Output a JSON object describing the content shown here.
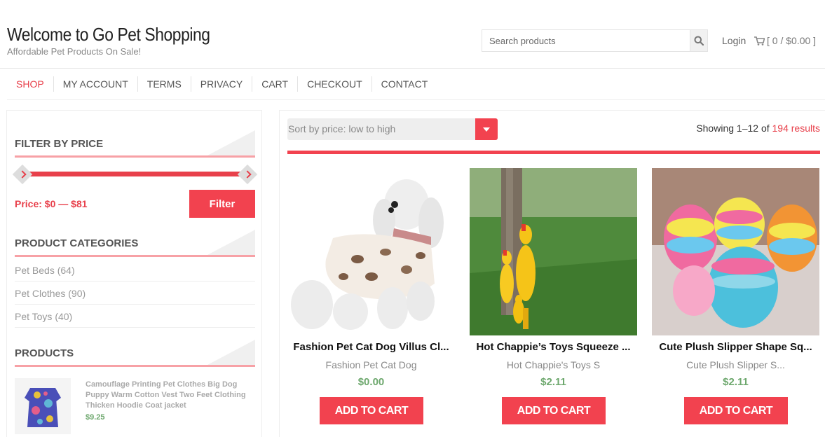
{
  "header": {
    "site_title": "Welcome to Go Pet Shopping",
    "tagline": "Affordable Pet Products On Sale!",
    "search_placeholder": "Search products",
    "login": "Login",
    "cart_summary": "[ 0 / $0.00 ]"
  },
  "nav": {
    "items": [
      "SHOP",
      "MY ACCOUNT",
      "TERMS",
      "PRIVACY",
      "CART",
      "CHECKOUT",
      "CONTACT"
    ],
    "active": "SHOP"
  },
  "sidebar": {
    "price_filter": {
      "title": "FILTER BY PRICE",
      "price_label": "Price: $0 — $81",
      "min": 0,
      "max": 81,
      "button": "Filter"
    },
    "categories": {
      "title": "PRODUCT CATEGORIES",
      "items": [
        "Pet Beds (64)",
        "Pet Clothes (90)",
        "Pet Toys (40)"
      ]
    },
    "products": {
      "title": "PRODUCTS",
      "item": {
        "title": "Camouflage Printing Pet Clothes Big Dog Puppy Warm Cotton Vest Two Feet Clothing Thicken Hoodie Coat jacket",
        "price": "$9.25"
      }
    }
  },
  "main": {
    "sort_label": "Sort by price: low to high",
    "results_prefix": "Showing 1–12 of ",
    "results_highlight": "194 results",
    "products": [
      {
        "title": "Fashion Pet Cat Dog Villus Cl...",
        "subtitle": "Fashion Pet Cat Dog",
        "price": "$0.00",
        "button": "ADD TO CART"
      },
      {
        "title": "Hot Chappie’s Toys Squeeze ...",
        "subtitle": "Hot Chappie's Toys S",
        "price": "$2.11",
        "button": "ADD TO CART"
      },
      {
        "title": "Cute Plush Slipper Shape Sq...",
        "subtitle": "Cute Plush Slipper S...",
        "price": "$2.11",
        "button": "ADD TO CART"
      }
    ]
  },
  "colors": {
    "accent": "#f2424f",
    "price_green": "#6ea86e"
  },
  "icons": [
    "search-icon",
    "cart-icon",
    "chevron-left-icon",
    "chevron-right-icon",
    "dropdown-arrow-icon"
  ]
}
